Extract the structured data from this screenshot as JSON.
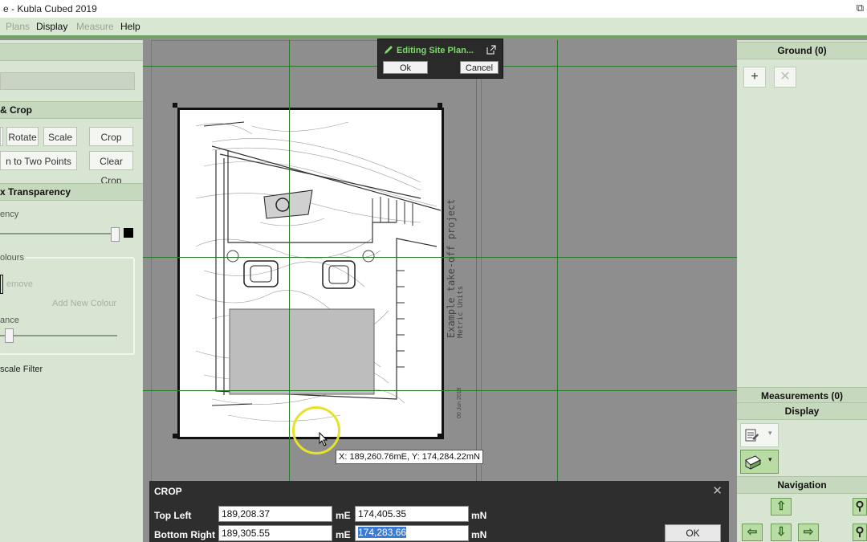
{
  "window": {
    "title": "e - Kubla Cubed 2019",
    "restore_glyph": "⧉"
  },
  "menu": [
    {
      "label": "Plans",
      "disabled": true
    },
    {
      "label": "Display",
      "disabled": false
    },
    {
      "label": "Measure",
      "disabled": true
    },
    {
      "label": "Help",
      "disabled": false
    }
  ],
  "left_panel": {
    "crop_header": "& Crop",
    "rotate_label": "Rotate",
    "scale_label": "Scale",
    "crop_label": "Crop",
    "two_points_label": "n to Two Points",
    "clear_crop_label": "Clear Crop",
    "transparency_header": "x Transparency",
    "transparency_label": "ency",
    "colours_label": "olours",
    "remove_label": "emove",
    "add_colour_label": "Add New Colour",
    "tolerance_label": "ance",
    "grayscale_label": "scale Filter"
  },
  "editing": {
    "title": "Editing Site Plan...",
    "ok_label": "Ok",
    "cancel_label": "Cancel"
  },
  "coordinate_tooltip": "X: 189,260.76mE, Y: 174,284.22mN",
  "plan_sheet": {
    "project_text": "Example take-off project",
    "units_text": "Metric Units",
    "date_text": "00 Jun 2019"
  },
  "right_panel": {
    "ground_header": "Ground (0)",
    "add_icon": "+",
    "delete_icon": "✕",
    "measurements_header": "Measurements (0)",
    "display_header": "Display",
    "navigation_header": "Navigation"
  },
  "crop_dialog": {
    "title": "CROP",
    "close_glyph": "✕",
    "top_left_label": "Top Left",
    "bottom_right_label": "Bottom Right",
    "top_left_e": "189,208.37",
    "top_left_n": "174,405.35",
    "bottom_right_e": "189,305.55",
    "bottom_right_n": "174,283.66",
    "unit_e": "mE",
    "unit_n": "mN",
    "ok_label": "OK"
  },
  "colors": {
    "accent_green": "#6f9f61",
    "badge_title": "#7ddc6a",
    "grid_line": "#2b7a2b"
  }
}
